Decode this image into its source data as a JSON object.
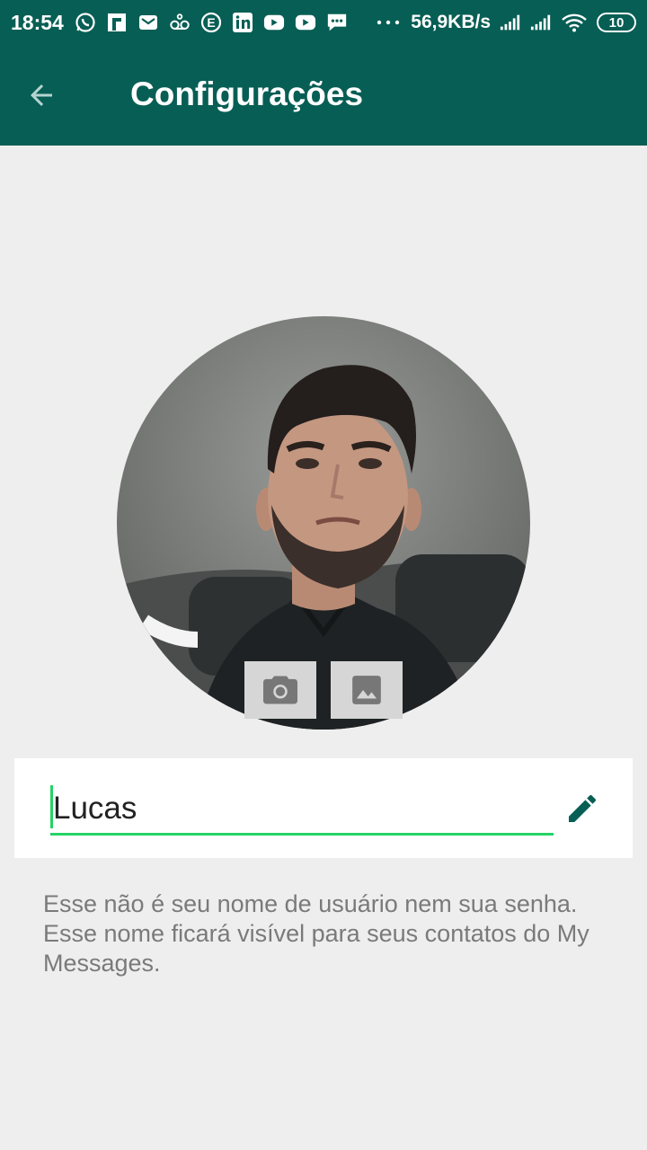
{
  "status_bar": {
    "time": "18:54",
    "speed": "56,9KB/s",
    "battery": "10",
    "notification_icons": [
      "whatsapp-icon",
      "flipboard-icon",
      "gmail-icon",
      "voicemail-icon",
      "app-e-icon",
      "linkedin-icon",
      "youtube-icon",
      "youtube-icon",
      "message-icon"
    ]
  },
  "toolbar": {
    "title": "Configurações"
  },
  "profile": {
    "name_value": "Lucas"
  },
  "helper_text": "Esse não é seu nome de usuário nem sua senha. Esse nome ficará visível para seus contatos do My Messages.",
  "colors": {
    "primary": "#075e54",
    "accent": "#25d366",
    "background": "#eeeeee"
  }
}
